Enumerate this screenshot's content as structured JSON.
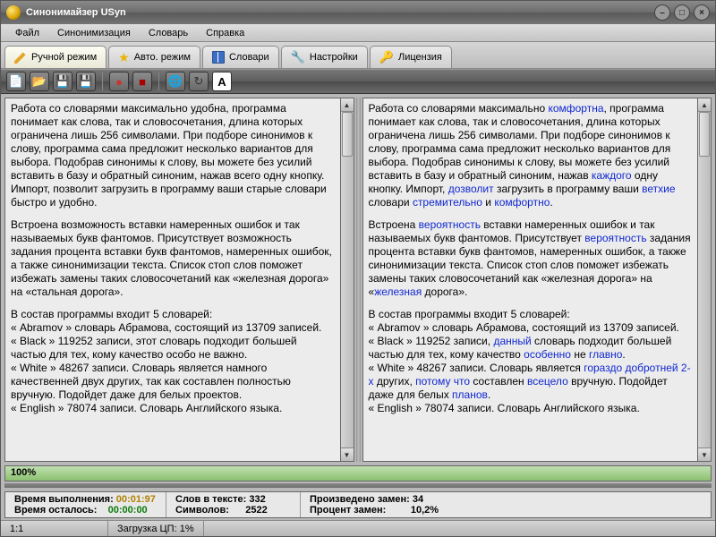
{
  "window": {
    "title": "Синонимайзер USyn"
  },
  "menu": {
    "file": "Файл",
    "syn": "Синонимизация",
    "dict": "Словарь",
    "help": "Справка"
  },
  "tabs": {
    "manual": "Ручной режим",
    "auto": "Авто. режим",
    "dicts": "Словари",
    "settings": "Настройки",
    "license": "Лицензия"
  },
  "left": {
    "p1": "Работа со словарями максимально удобна, программа понимает как слова, так и словосочетания, длина которых ограничена лишь 256 символами. При подборе синонимов к слову, программа сама предложит несколько вариантов для выбора. Подобрав синонимы к слову, вы можете без усилий вставить в базу и обратный синоним, нажав всего одну кнопку. Импорт, позволит загрузить в программу ваши старые словари быстро и удобно.",
    "p2": "Встроена возможность вставки намеренных ошибок и так называемых букв фантомов. Присутствует возможность задания процента вставки букв фантомов, намеренных ошибок, а также синонимизации текста. Список стоп слов поможет избежать замены таких словосочетаний как «железная дорога» на «стальная дорога».",
    "p3a": "В состав программы входит 5 словарей:",
    "p3b": "« Abramov » словарь Абрамова, состоящий из 13709 записей.",
    "p3c": "« Black » 119252 записи, этот словарь подходит большей частью для тех, кому качество особо не важно.",
    "p3d": "« White » 48267 записи. Словарь является намного качественней двух других, так как составлен полностью вручную. Подойдет даже для белых проектов.",
    "p3e": "« English » 78074 записи. Словарь Английского языка."
  },
  "right": {
    "p1a": "Работа со словарями максимально ",
    "s1": "комфортна",
    "p1b": ", программа понимает как слова, так и словосочетания, длина которых ограничена лишь 256 символами. При подборе синонимов к слову, программа сама предложит несколько вариантов для выбора. Подобрав синонимы к слову, вы можете без усилий вставить в базу и обратный синоним, нажав ",
    "s2": "каждого",
    "p1c": " одну кнопку. Импорт, ",
    "s3": "дозволит",
    "p1d": " загрузить в программу ваши ",
    "s4": "ветхие",
    "p1e": " словари ",
    "s5": "стремительно",
    "p1f": " и ",
    "s6": "комфортно",
    "p1g": ".",
    "p2a": "Встроена ",
    "s7": "вероятность",
    "p2b": " вставки намеренных ошибок и так называемых букв фантомов. Присутствует ",
    "s8": "вероятность",
    "p2c": " задания процента вставки букв фантомов, намеренных ошибок, а также синонимизации текста. Список стоп слов поможет избежать замены таких словосочетаний как «железная дорога» на «",
    "s9": "железная",
    "p2d": " дорога».",
    "p3a": "В состав программы входит 5 словарей:",
    "p3b": "« Abramov » словарь Абрамова, состоящий из 13709 записей.",
    "p3c1": "« Black » 119252 записи, ",
    "s10": "данный",
    "p3c2": " словарь подходит большей частью для тех, кому качество ",
    "s11": "особенно",
    "p3c3": " не ",
    "s12": "главно",
    "p3c4": ".",
    "p3d1": "« White » 48267 записи. Словарь является ",
    "s13": "гораздо добротней 2-х",
    "p3d2": " других, ",
    "s14": "потому что",
    "p3d3": " составлен ",
    "s15": "всецело",
    "p3d4": " вручную. Подойдет даже для белых ",
    "s16": "планов",
    "p3d5": ".",
    "p3e": "« English » 78074 записи. Словарь Английского языка."
  },
  "progress": {
    "label": "100%"
  },
  "stats": {
    "elapsed_label": "Время выполнения:",
    "elapsed_value": "00:01:97",
    "remain_label": "Время осталось:",
    "remain_value": "00:00:00",
    "words_label": "Слов в тексте:",
    "words_value": "332",
    "chars_label": "Символов:",
    "chars_value": "2522",
    "replace_label": "Произведено замен:",
    "replace_value": "34",
    "pct_label": "Процент замен:",
    "pct_value": "10,2%"
  },
  "status": {
    "pos": "1:1",
    "cpu": "Загрузка ЦП: 1%"
  }
}
